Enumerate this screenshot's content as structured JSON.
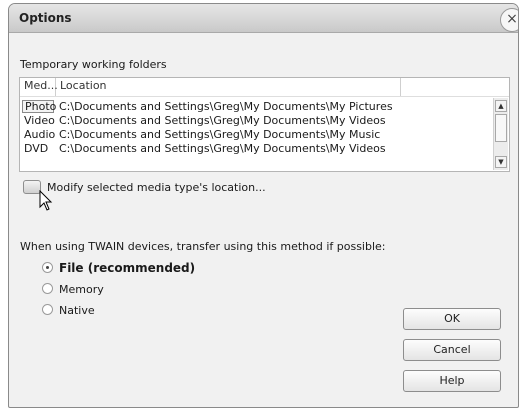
{
  "window": {
    "title": "Options",
    "close_glyph": "×"
  },
  "folders": {
    "section_label": "Temporary working folders",
    "columns": [
      "Med...",
      "Location"
    ],
    "rows": [
      {
        "type": "Photo",
        "location": "C:\\Documents and Settings\\Greg\\My Documents\\My Pictures",
        "selected": true
      },
      {
        "type": "Video",
        "location": "C:\\Documents and Settings\\Greg\\My Documents\\My Videos",
        "selected": false
      },
      {
        "type": "Audio",
        "location": "C:\\Documents and Settings\\Greg\\My Documents\\My Music",
        "selected": false
      },
      {
        "type": "DVD",
        "location": "C:\\Documents and Settings\\Greg\\My Documents\\My Videos",
        "selected": false
      }
    ],
    "modify_label": "Modify selected media type's location..."
  },
  "twain": {
    "prompt": "When using TWAIN devices, transfer using this method if possible:",
    "options": [
      {
        "label": "File (recommended)",
        "checked": true
      },
      {
        "label": "Memory",
        "checked": false
      },
      {
        "label": "Native",
        "checked": false
      }
    ]
  },
  "buttons": {
    "ok": "OK",
    "cancel": "Cancel",
    "help": "Help"
  },
  "icons": {
    "scroll_up": "up-arrow-icon",
    "scroll_down": "down-arrow-icon",
    "cursor": "mouse-pointer-icon"
  }
}
